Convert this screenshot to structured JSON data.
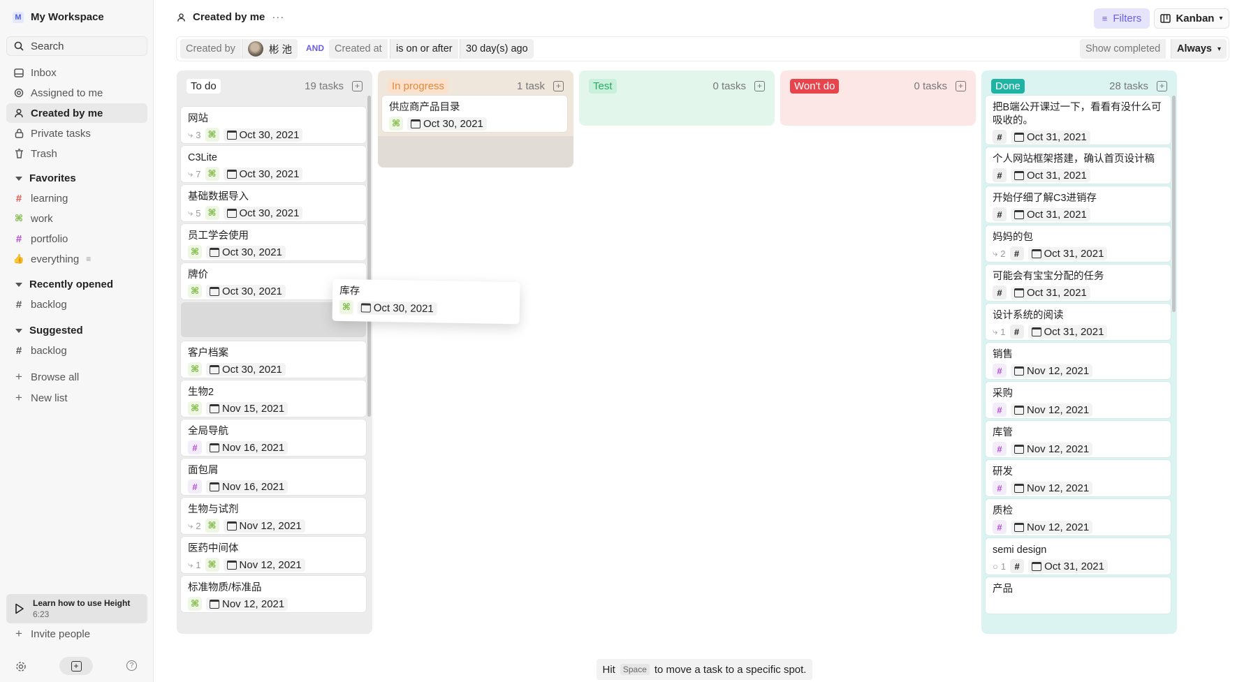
{
  "sidebar": {
    "workspace": {
      "badge": "M",
      "name": "My Workspace"
    },
    "search_label": "Search",
    "nav": [
      {
        "label": "Inbox",
        "icon": "inbox-icon"
      },
      {
        "label": "Assigned to me",
        "icon": "target-icon"
      },
      {
        "label": "Created by me",
        "icon": "user-icon",
        "active": true
      },
      {
        "label": "Private tasks",
        "icon": "lock-icon"
      },
      {
        "label": "Trash",
        "icon": "trash-icon"
      }
    ],
    "favorites_title": "Favorites",
    "favorites": [
      {
        "label": "learning",
        "color": "#e8574f"
      },
      {
        "label": "work",
        "color": "#78b63c"
      },
      {
        "label": "portfolio",
        "color": "#b64bd6"
      },
      {
        "label": "everything",
        "color": "#e6a23c"
      }
    ],
    "recent_title": "Recently opened",
    "recent": [
      {
        "label": "backlog"
      }
    ],
    "suggested_title": "Suggested",
    "suggested": [
      {
        "label": "backlog"
      }
    ],
    "browse_all": "Browse all",
    "new_list": "New list",
    "learn": {
      "title": "Learn how to use Height",
      "duration": "6:23"
    },
    "invite": "Invite people"
  },
  "header": {
    "title": "Created by me",
    "filters_label": "Filters",
    "view_label": "Kanban"
  },
  "filters": {
    "created_by_label": "Created by",
    "created_by_value": "彬 池",
    "and_label": "AND",
    "created_at_label": "Created at",
    "operator": "is on or after",
    "value": "30 day(s) ago",
    "show_completed_label": "Show completed",
    "show_completed_value": "Always"
  },
  "columns": [
    {
      "label": "To do",
      "count": "19 tasks",
      "bg": "#ececec",
      "label_bg": "#ffffff",
      "label_color": "#222222"
    },
    {
      "label": "In progress",
      "count": "1 task",
      "bg": "#efe6dc",
      "label_bg": "#fbe0cc",
      "label_color": "#e08b3f"
    },
    {
      "label": "Test",
      "count": "0 tasks",
      "bg": "#e3f6ec",
      "label_bg": "#c8f0da",
      "label_color": "#2aa866"
    },
    {
      "label": "Won't do",
      "count": "0 tasks",
      "bg": "#fde6e6",
      "label_bg": "#e8444c",
      "label_color": "#ffffff"
    },
    {
      "label": "Done",
      "count": "28 tasks",
      "bg": "#dbf4f2",
      "label_bg": "#1fb3a4",
      "label_color": "#ffffff"
    }
  ],
  "todo_cards": [
    {
      "title": "网站",
      "subtasks": "3",
      "tag": "work",
      "date": "Oct 30, 2021"
    },
    {
      "title": "C3Lite",
      "subtasks": "7",
      "tag": "work",
      "date": "Oct 30, 2021"
    },
    {
      "title": "基础数据导入",
      "subtasks": "5",
      "tag": "work",
      "date": "Oct 30, 2021"
    },
    {
      "title": "员工学会使用",
      "subtasks": "",
      "tag": "work",
      "date": "Oct 30, 2021"
    },
    {
      "title": "牌价",
      "subtasks": "",
      "tag": "work",
      "date": "Oct 30, 2021"
    },
    {
      "title": "客户档案",
      "subtasks": "",
      "tag": "work",
      "date": "Oct 30, 2021"
    },
    {
      "title": "生物2",
      "subtasks": "",
      "tag": "work",
      "date": "Nov 15, 2021"
    },
    {
      "title": "全局导航",
      "subtasks": "",
      "tag": "portfolio",
      "date": "Nov 16, 2021"
    },
    {
      "title": "面包屑",
      "subtasks": "",
      "tag": "portfolio",
      "date": "Nov 16, 2021"
    },
    {
      "title": "生物与试剂",
      "subtasks": "2",
      "tag": "work",
      "date": "Nov 12, 2021"
    },
    {
      "title": "医药中间体",
      "subtasks": "1",
      "tag": "work",
      "date": "Nov 12, 2021"
    },
    {
      "title": "标准物质/标准品",
      "subtasks": "",
      "tag": "work",
      "date": "Nov 12, 2021"
    }
  ],
  "inprogress_cards": [
    {
      "title": "供应商产品目录",
      "tag": "work",
      "date": "Oct 30, 2021"
    }
  ],
  "dragging_card": {
    "title": "库存",
    "tag": "work",
    "date": "Oct 30, 2021"
  },
  "done_cards": [
    {
      "title": "把B端公开课过一下，看看有没什么可吸收的。",
      "sub": "",
      "tag": "dark",
      "date": "Oct 31, 2021"
    },
    {
      "title": "个人网站框架搭建，确认首页设计稿",
      "sub": "",
      "tag": "dark",
      "date": "Oct 31, 2021"
    },
    {
      "title": "开始仔细了解C3进销存",
      "sub": "",
      "tag": "dark",
      "date": "Oct 31, 2021"
    },
    {
      "title": "妈妈的包",
      "sub": "2",
      "tag": "dark",
      "date": "Oct 31, 2021"
    },
    {
      "title": "可能会有宝宝分配的任务",
      "sub": "",
      "tag": "dark",
      "date": "Oct 31, 2021"
    },
    {
      "title": "设计系统的阅读",
      "sub": "1",
      "tag": "dark",
      "date": "Oct 31, 2021"
    },
    {
      "title": "销售",
      "sub": "",
      "tag": "portfolio",
      "date": "Nov 12, 2021"
    },
    {
      "title": "采购",
      "sub": "",
      "tag": "portfolio",
      "date": "Nov 12, 2021"
    },
    {
      "title": "库管",
      "sub": "",
      "tag": "portfolio",
      "date": "Nov 12, 2021"
    },
    {
      "title": "研发",
      "sub": "",
      "tag": "portfolio",
      "date": "Nov 12, 2021"
    },
    {
      "title": "质检",
      "sub": "",
      "tag": "portfolio",
      "date": "Nov 12, 2021"
    },
    {
      "title": "semi design",
      "comments": "1",
      "tag": "dark",
      "date": "Oct 31, 2021"
    },
    {
      "title": "产品",
      "sub": "",
      "tag": "dark",
      "date": ""
    }
  ],
  "toast": {
    "pre": "Hit",
    "key": "Space",
    "post": "to move a task to a specific spot."
  }
}
